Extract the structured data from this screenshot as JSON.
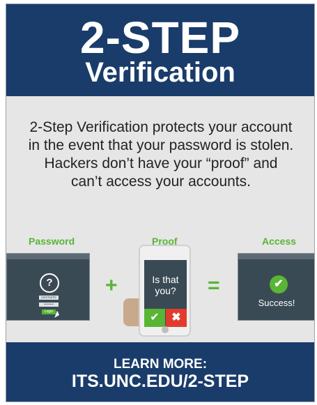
{
  "header": {
    "title": "2-STEP",
    "subtitle": "Verification"
  },
  "description": "2-Step Verification protects your account in the event that your password is stolen. Hackers don’t have your “proof” and can’t access your accounts.",
  "steps": {
    "password": {
      "label": "Password",
      "qmark": "?",
      "username": "username",
      "password": "••••••••",
      "login": "Login"
    },
    "plus": "+",
    "proof": {
      "label": "Proof",
      "prompt": "Is that you?",
      "yes": "✔",
      "no": "✖"
    },
    "equals": "=",
    "access": {
      "label": "Access",
      "check": "✔",
      "message": "Success!"
    }
  },
  "footer": {
    "learn_more": "LEARN MORE:",
    "url": "ITS.UNC.EDU/2-STEP"
  },
  "colors": {
    "navy": "#1a3c6b",
    "green": "#59b534",
    "red": "#e23b2e",
    "screen": "#3a4a55",
    "background": "#e6e6e6"
  },
  "icons": [
    "question-icon",
    "checkmark-icon",
    "close-icon",
    "cursor-icon"
  ]
}
